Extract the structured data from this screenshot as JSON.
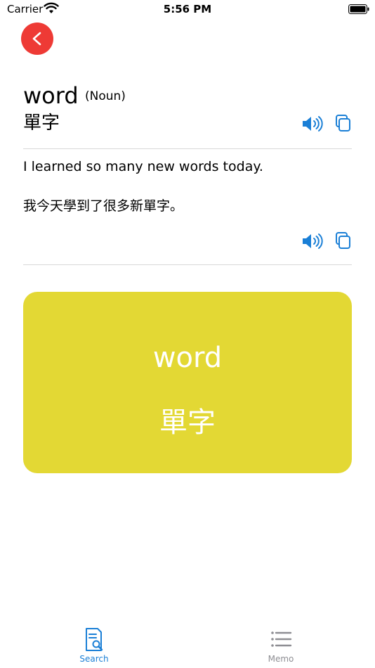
{
  "status_bar": {
    "carrier": "Carrier",
    "time": "5:56 PM"
  },
  "entry": {
    "word": "word",
    "part_of_speech": "(Noun)",
    "translation": "單字",
    "example_en": "I learned so many new words today.",
    "example_zh": "我今天學到了很多新單字。"
  },
  "flash_card": {
    "word": "word",
    "translation": "單字",
    "color": "#e3d834"
  },
  "tab_bar": {
    "tabs": [
      {
        "label": "Search",
        "icon": "search-doc-icon",
        "active": true
      },
      {
        "label": "Memo",
        "icon": "list-icon",
        "active": false
      }
    ]
  },
  "colors": {
    "accent": "#1a7fd6",
    "back_button": "#ee3a35",
    "inactive": "#8e8e93"
  }
}
